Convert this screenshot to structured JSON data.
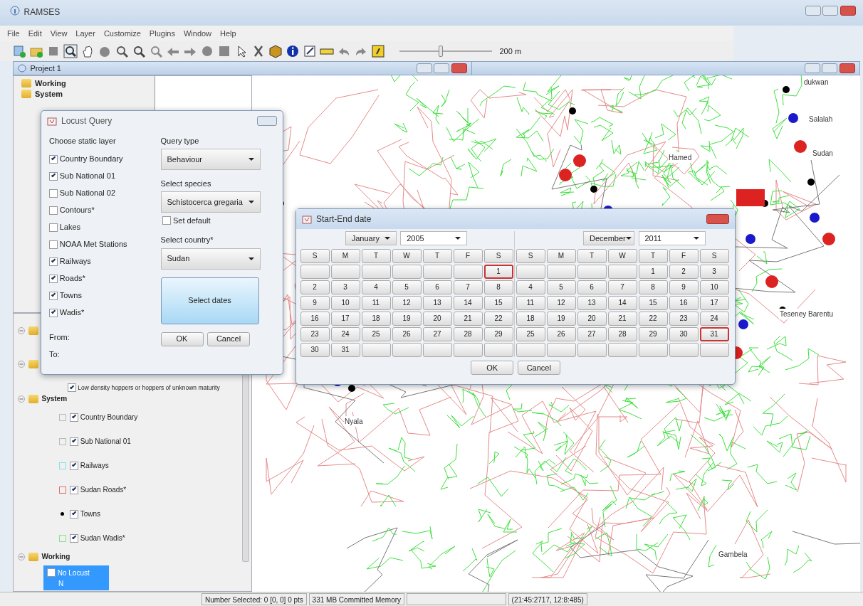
{
  "window": {
    "title": "RAMSES"
  },
  "menu": [
    "File",
    "Edit",
    "View",
    "Layer",
    "Customize",
    "Plugins",
    "Window",
    "Help"
  ],
  "zoom_slider": {
    "level": 0.45,
    "reading": "200 m"
  },
  "project": {
    "title": "Project 1",
    "top_tree": [
      {
        "label": "Working"
      },
      {
        "label": "System"
      }
    ],
    "layer_tree": [
      {
        "kind": "folder"
      },
      {
        "kind": "folder",
        "children": [
          {
            "kind": "layer",
            "label": "Low density hoppers or hoppers of unknown maturity",
            "checked": true
          }
        ]
      },
      {
        "kind": "folder",
        "label": "System",
        "children": [
          {
            "kind": "polygon",
            "label": "Country Boundary",
            "checked": true,
            "color": "#bbbbbb"
          },
          {
            "kind": "polygon",
            "label": "Sub National 01",
            "checked": true,
            "color": "#bbbbbb"
          },
          {
            "kind": "polygon",
            "label": "Railways",
            "checked": true,
            "color": "#7fe3e3"
          },
          {
            "kind": "polygon",
            "label": "Sudan Roads*",
            "checked": true,
            "color": "#e36b6b"
          },
          {
            "kind": "point",
            "label": "Towns",
            "checked": true,
            "color": "#000000"
          },
          {
            "kind": "polygon",
            "label": "Sudan Wadis*",
            "checked": true,
            "color": "#8ee08e"
          }
        ]
      },
      {
        "kind": "folder",
        "label": "Working",
        "children": [
          {
            "kind": "layer",
            "label": "No Locust",
            "checked": false,
            "selected": true,
            "note": "N"
          }
        ]
      }
    ]
  },
  "map": {
    "labels": [
      "dukwan",
      "Salalah",
      "Sudan",
      "Hamed",
      "Teseney Barentu",
      "Nyala",
      "Gambela"
    ]
  },
  "locust_query": {
    "title": "Locust Query",
    "layers_label": "Choose static layer",
    "layers": [
      {
        "label": "Country Boundary",
        "checked": true
      },
      {
        "label": "Sub National 01",
        "checked": true
      },
      {
        "label": "Sub National 02",
        "checked": false
      },
      {
        "label": "Contours*",
        "checked": false
      },
      {
        "label": "Lakes",
        "checked": false
      },
      {
        "label": "NOAA Met Stations",
        "checked": false
      },
      {
        "label": "Railways",
        "checked": true
      },
      {
        "label": "Roads*",
        "checked": true
      },
      {
        "label": "Towns",
        "checked": true
      },
      {
        "label": "Wadis*",
        "checked": true
      }
    ],
    "from_label": "From:",
    "to_label": "To:",
    "query_type": {
      "label": "Query type",
      "value": "Behaviour"
    },
    "species": {
      "label": "Select species",
      "value": "Schistocerca gregaria"
    },
    "set_default": {
      "label": "Set default",
      "checked": false
    },
    "country": {
      "label": "Select country*",
      "value": "Sudan"
    },
    "dates_button": "Select dates",
    "buttons": [
      "OK",
      "Cancel"
    ]
  },
  "date_dialog": {
    "title": "Start-End date",
    "buttons": [
      "OK",
      "Cancel"
    ],
    "calendars": [
      {
        "month": "January",
        "year": "2005",
        "weekdays": [
          "S",
          "M",
          "T",
          "W",
          "T",
          "F",
          "S"
        ],
        "weeks": [
          [
            {
              "kind": "blank"
            },
            {
              "kind": "blank"
            },
            {
              "kind": "blank"
            },
            {
              "kind": "blank"
            },
            {
              "kind": "blank"
            },
            {
              "kind": "blank"
            },
            {
              "kind": "day",
              "day": "1",
              "selected": true
            }
          ],
          [
            {
              "kind": "day",
              "day": "2",
              "selected": false
            },
            {
              "kind": "day",
              "day": "3",
              "selected": false
            },
            {
              "kind": "day",
              "day": "4",
              "selected": false
            },
            {
              "kind": "day",
              "day": "5",
              "selected": false
            },
            {
              "kind": "day",
              "day": "6",
              "selected": false
            },
            {
              "kind": "day",
              "day": "7",
              "selected": false
            },
            {
              "kind": "day",
              "day": "8",
              "selected": false
            }
          ],
          [
            {
              "kind": "day",
              "day": "9",
              "selected": false
            },
            {
              "kind": "day",
              "day": "10",
              "selected": false
            },
            {
              "kind": "day",
              "day": "11",
              "selected": false
            },
            {
              "kind": "day",
              "day": "12",
              "selected": false
            },
            {
              "kind": "day",
              "day": "13",
              "selected": false
            },
            {
              "kind": "day",
              "day": "14",
              "selected": false
            },
            {
              "kind": "day",
              "day": "15",
              "selected": false
            }
          ],
          [
            {
              "kind": "day",
              "day": "16",
              "selected": false
            },
            {
              "kind": "day",
              "day": "17",
              "selected": false
            },
            {
              "kind": "day",
              "day": "18",
              "selected": false
            },
            {
              "kind": "day",
              "day": "19",
              "selected": false
            },
            {
              "kind": "day",
              "day": "20",
              "selected": false
            },
            {
              "kind": "day",
              "day": "21",
              "selected": false
            },
            {
              "kind": "day",
              "day": "22",
              "selected": false
            }
          ],
          [
            {
              "kind": "day",
              "day": "23",
              "selected": false
            },
            {
              "kind": "day",
              "day": "24",
              "selected": false
            },
            {
              "kind": "day",
              "day": "25",
              "selected": false
            },
            {
              "kind": "day",
              "day": "26",
              "selected": false
            },
            {
              "kind": "day",
              "day": "27",
              "selected": false
            },
            {
              "kind": "day",
              "day": "28",
              "selected": false
            },
            {
              "kind": "day",
              "day": "29",
              "selected": false
            }
          ],
          [
            {
              "kind": "day",
              "day": "30",
              "selected": false
            },
            {
              "kind": "day",
              "day": "31",
              "selected": false
            },
            {
              "kind": "blank"
            },
            {
              "kind": "blank"
            },
            {
              "kind": "blank"
            },
            {
              "kind": "blank"
            },
            {
              "kind": "blank"
            }
          ]
        ]
      },
      {
        "month": "December",
        "year": "2011",
        "weekdays": [
          "S",
          "M",
          "T",
          "W",
          "T",
          "F",
          "S"
        ],
        "weeks": [
          [
            {
              "kind": "blank"
            },
            {
              "kind": "blank"
            },
            {
              "kind": "blank"
            },
            {
              "kind": "blank"
            },
            {
              "kind": "day",
              "day": "1",
              "selected": false
            },
            {
              "kind": "day",
              "day": "2",
              "selected": false
            },
            {
              "kind": "day",
              "day": "3",
              "selected": false
            }
          ],
          [
            {
              "kind": "day",
              "day": "4",
              "selected": false
            },
            {
              "kind": "day",
              "day": "5",
              "selected": false
            },
            {
              "kind": "day",
              "day": "6",
              "selected": false
            },
            {
              "kind": "day",
              "day": "7",
              "selected": false
            },
            {
              "kind": "day",
              "day": "8",
              "selected": false
            },
            {
              "kind": "day",
              "day": "9",
              "selected": false
            },
            {
              "kind": "day",
              "day": "10",
              "selected": false
            }
          ],
          [
            {
              "kind": "day",
              "day": "11",
              "selected": false
            },
            {
              "kind": "day",
              "day": "12",
              "selected": false
            },
            {
              "kind": "day",
              "day": "13",
              "selected": false
            },
            {
              "kind": "day",
              "day": "14",
              "selected": false
            },
            {
              "kind": "day",
              "day": "15",
              "selected": false
            },
            {
              "kind": "day",
              "day": "16",
              "selected": false
            },
            {
              "kind": "day",
              "day": "17",
              "selected": false
            }
          ],
          [
            {
              "kind": "day",
              "day": "18",
              "selected": false
            },
            {
              "kind": "day",
              "day": "19",
              "selected": false
            },
            {
              "kind": "day",
              "day": "20",
              "selected": false
            },
            {
              "kind": "day",
              "day": "21",
              "selected": false
            },
            {
              "kind": "day",
              "day": "22",
              "selected": false
            },
            {
              "kind": "day",
              "day": "23",
              "selected": false
            },
            {
              "kind": "day",
              "day": "24",
              "selected": false
            }
          ],
          [
            {
              "kind": "day",
              "day": "25",
              "selected": false
            },
            {
              "kind": "day",
              "day": "26",
              "selected": false
            },
            {
              "kind": "day",
              "day": "27",
              "selected": false
            },
            {
              "kind": "day",
              "day": "28",
              "selected": false
            },
            {
              "kind": "day",
              "day": "29",
              "selected": false
            },
            {
              "kind": "day",
              "day": "30",
              "selected": false
            },
            {
              "kind": "day",
              "day": "31",
              "selected": true
            }
          ],
          [
            {
              "kind": "blank"
            },
            {
              "kind": "blank"
            },
            {
              "kind": "blank"
            },
            {
              "kind": "blank"
            },
            {
              "kind": "blank"
            },
            {
              "kind": "blank"
            },
            {
              "kind": "blank"
            }
          ]
        ]
      }
    ]
  },
  "status_bar": [
    "Number Selected: 0 [0, 0] 0 pts",
    "331 MB Committed Memory",
    "(21:45:2717, 12:8:485)"
  ]
}
